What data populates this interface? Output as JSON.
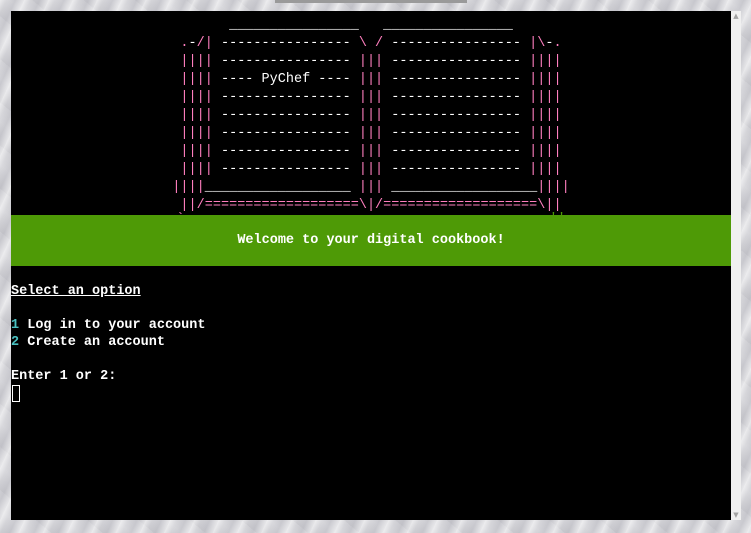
{
  "colors": {
    "terminal_bg": "#000000",
    "banner_bg": "#4e9a06",
    "text": "#ffffff",
    "number": "#4ac0c0",
    "art_border": "#ff7fbf",
    "art_lines": "#ffffff",
    "art_accent": "#4e9a06"
  },
  "ascii_art": {
    "lines": [
      "  ________________   ________________  ",
      ".-/| ---------------- \\ / ---------------- |\\-.",
      "|||| ---------------- ||| ---------------- ||||",
      "|||| ---- PyChef ---- ||| ---------------- ||||",
      "|||| ---------------- ||| ---------------- ||||",
      "|||| ---------------- ||| ---------------- ||||",
      "|||| ---------------- ||| ---------------- ||||",
      "|||| ---------------- ||| ---------------- ||||",
      "|||| ---------------- ||| ---------------- ||||",
      "||||__________________ ||| __________________||||",
      "||/===================\\|/===================\\||",
      "`--------------------~___~--------------------''"
    ]
  },
  "banner": {
    "text": "Welcome to your digital cookbook!"
  },
  "menu": {
    "heading": "Select an option",
    "options": [
      {
        "number": "1",
        "label": "Log in to your account"
      },
      {
        "number": "2",
        "label": "Create an account"
      }
    ],
    "prompt": "Enter 1 or 2:"
  },
  "icons": {
    "scroll_up": "scroll-up-arrow-icon",
    "scroll_down": "scroll-down-arrow-icon"
  }
}
